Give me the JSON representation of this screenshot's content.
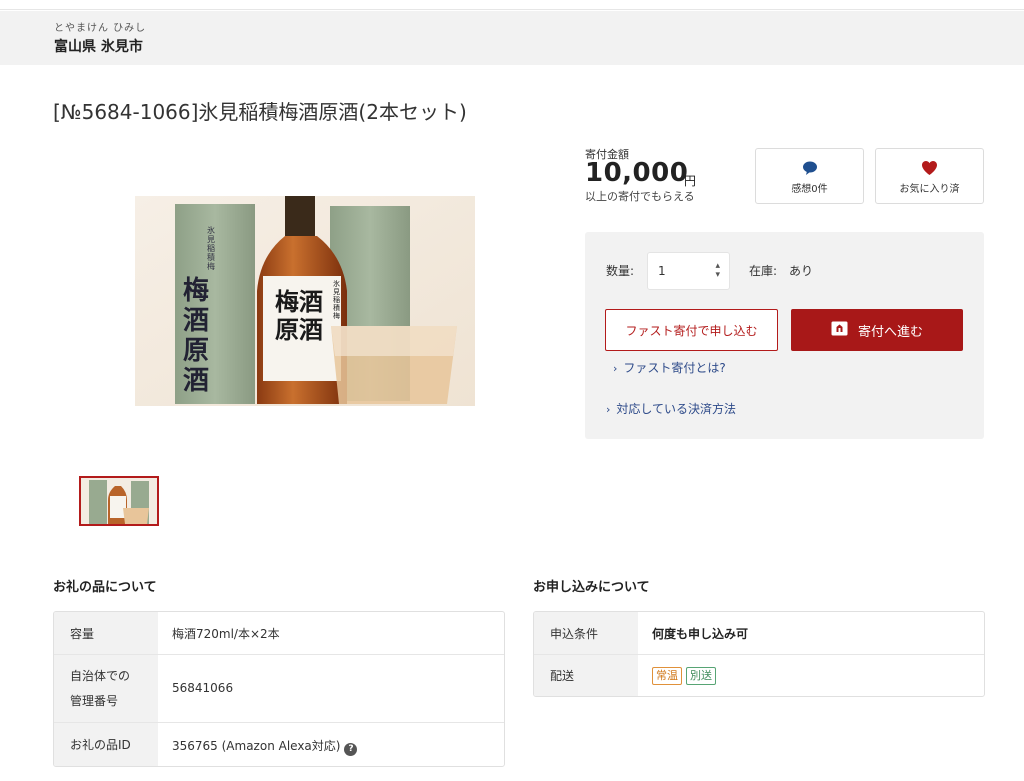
{
  "region": {
    "ruby": "とやまけん ひみし",
    "name": "富山県 氷見市"
  },
  "item": {
    "title": "[№5684-1066]氷見稲積梅酒原酒(2本セット)"
  },
  "donation": {
    "label": "寄付金額",
    "amount": "10,000",
    "unit": "円",
    "note": "以上の寄付でもらえる"
  },
  "actions": {
    "review_label": "感想0件",
    "favorite_label": "お気に入り済"
  },
  "order": {
    "qty_label": "数量:",
    "qty_value": "1",
    "stock_label": "在庫:",
    "stock_value": "あり",
    "fast_button": "ファスト寄付で申し込む",
    "go_button": "寄付へ進む",
    "fast_link": "ファスト寄付とは?",
    "payment_link": "対応している決済方法"
  },
  "photo": {
    "box_text": "梅酒原酒",
    "box_small": "氷見稲積梅",
    "label_text": "梅酒原酒",
    "label_small": "氷見稲積梅"
  },
  "about": {
    "title": "お礼の品について",
    "rows": [
      {
        "key": "容量",
        "value": "梅酒720ml/本×2本"
      },
      {
        "key_line1": "自治体での",
        "key_line2": "管理番号",
        "value": "56841066"
      },
      {
        "key": "お礼の品ID",
        "value": "356765 (Amazon Alexa対応)"
      }
    ]
  },
  "apply": {
    "title": "お申し込みについて",
    "rows": [
      {
        "key": "申込条件",
        "value": "何度も申し込み可"
      },
      {
        "key": "配送",
        "tags": [
          "常温",
          "別送"
        ]
      }
    ]
  },
  "colors": {
    "accent": "#a81818",
    "link": "#2e4b8a",
    "panel": "#f2f2f2"
  }
}
